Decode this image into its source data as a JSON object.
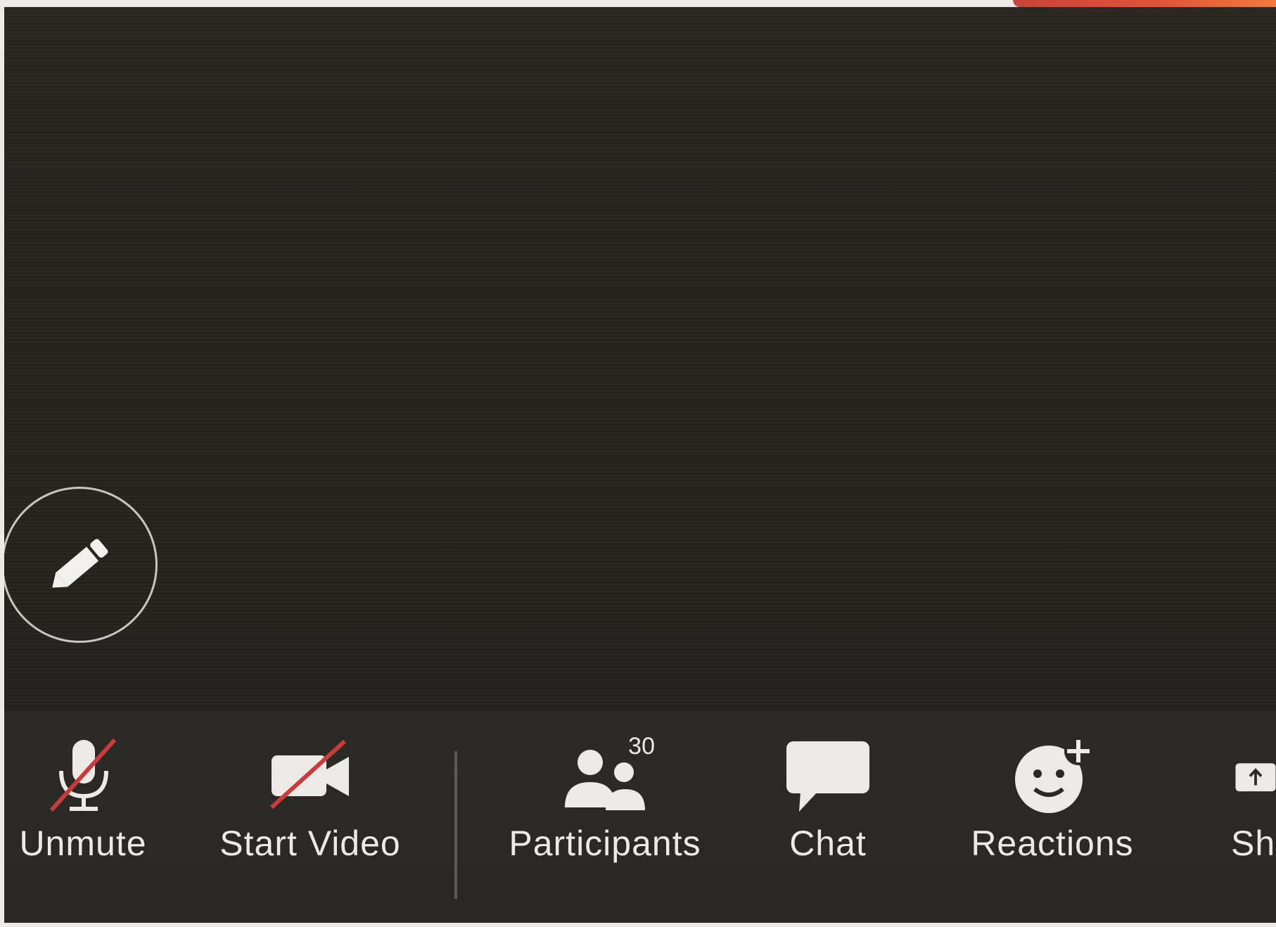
{
  "toolbar": {
    "unmute_label": "Unmute",
    "start_video_label": "Start Video",
    "participants_label": "Participants",
    "participants_count": "30",
    "chat_label": "Chat",
    "reactions_label": "Reactions",
    "share_label_partial": "Sh"
  },
  "colors": {
    "background": "#26241f",
    "toolbar": "#2b2925",
    "icon": "#eceae6",
    "muted_slash": "#c83c3c",
    "top_accent": "#e0533a"
  },
  "icons": {
    "annotate": "pencil-icon",
    "unmute": "microphone-muted-icon",
    "video": "video-camera-off-icon",
    "participants": "people-icon",
    "chat": "speech-bubble-icon",
    "reactions": "smiley-plus-icon",
    "share": "share-screen-icon"
  }
}
